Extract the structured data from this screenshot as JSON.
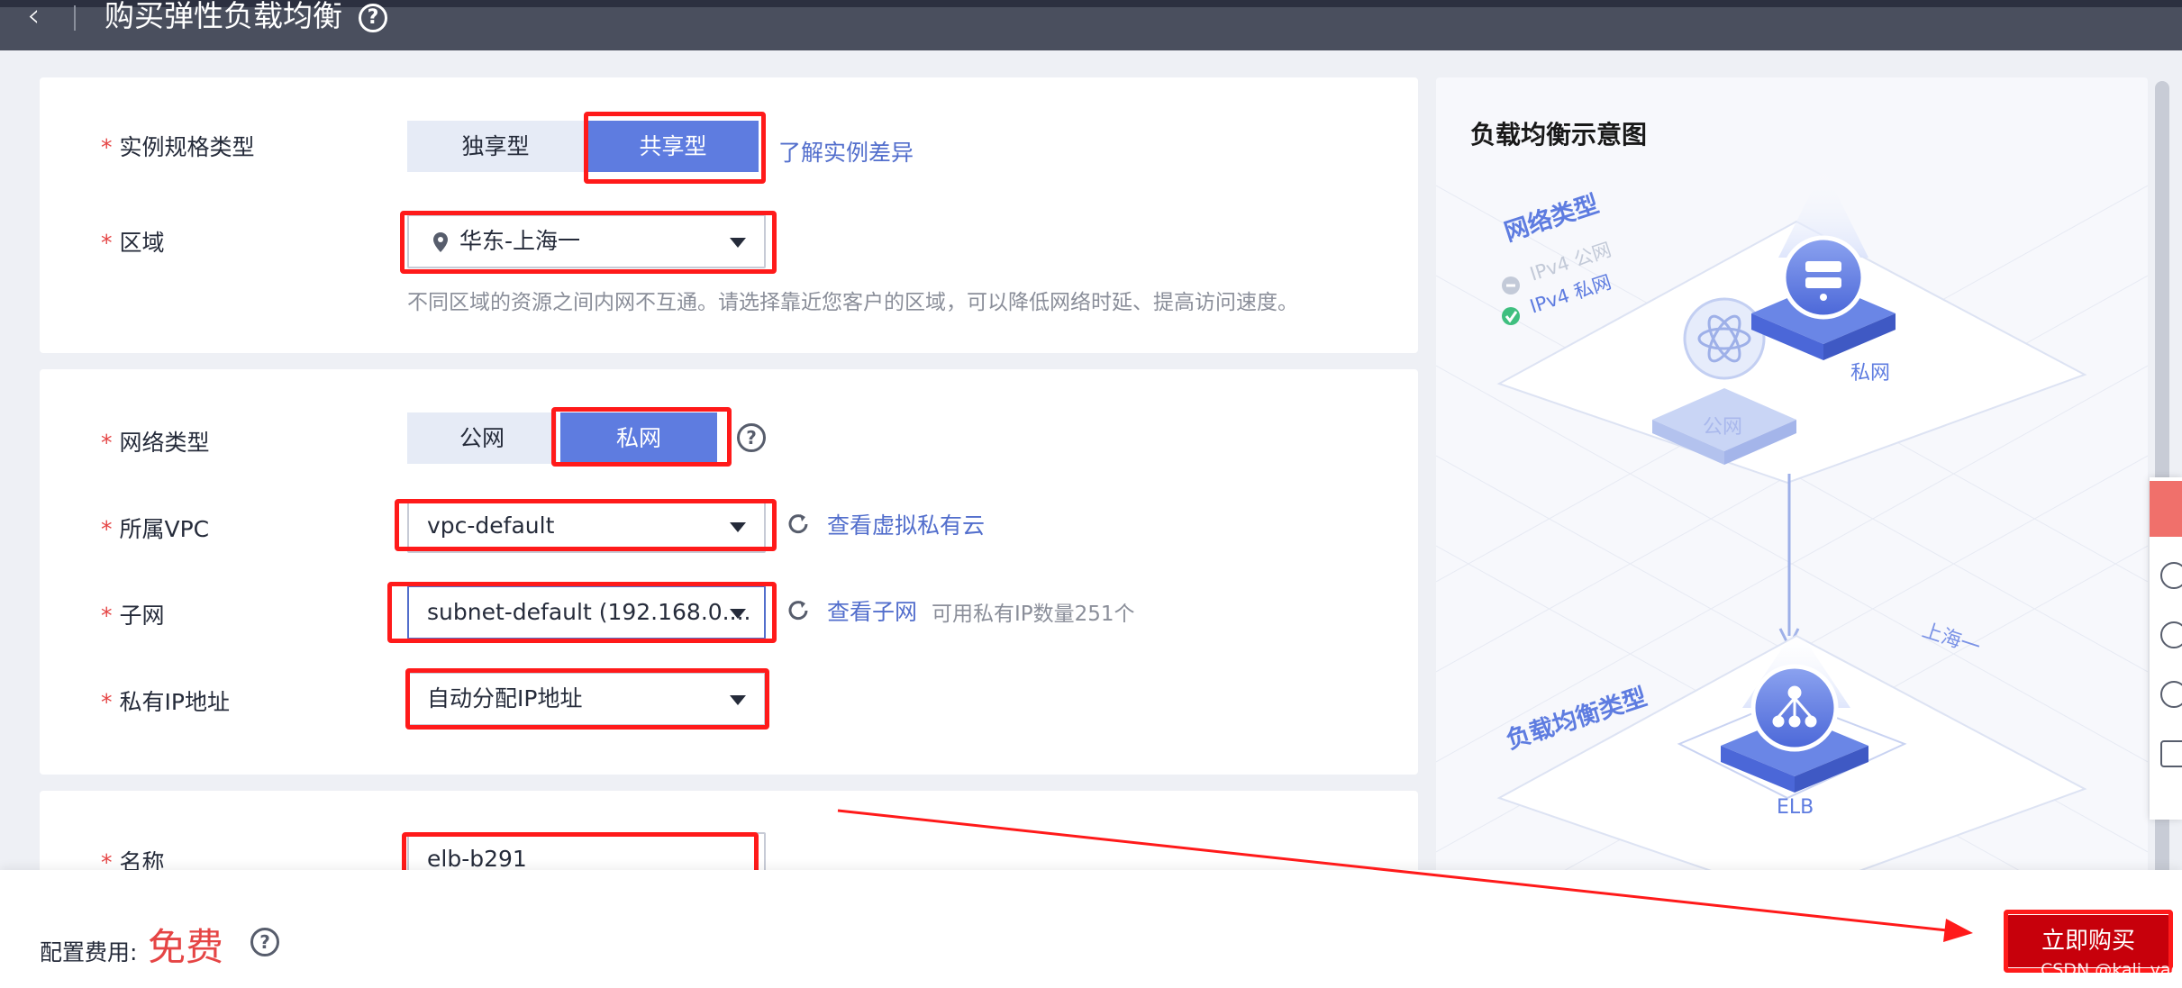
{
  "header": {
    "title": "购买弹性负载均衡",
    "help_glyph": "?"
  },
  "spec": {
    "label": "实例规格类型",
    "options": [
      "独享型",
      "共享型"
    ],
    "selected": "共享型",
    "link": "了解实例差异"
  },
  "region": {
    "label": "区域",
    "value": "华东-上海一",
    "hint": "不同区域的资源之间内网不互通。请选择靠近您客户的区域，可以降低网络时延、提高访问速度。"
  },
  "network": {
    "label": "网络类型",
    "options": [
      "公网",
      "私网"
    ],
    "selected": "私网"
  },
  "vpc": {
    "label": "所属VPC",
    "value": "vpc-default",
    "link": "查看虚拟私有云"
  },
  "subnet": {
    "label": "子网",
    "value": "subnet-default (192.168.0....",
    "link": "查看子网",
    "hint": "可用私有IP数量251个"
  },
  "private_ip": {
    "label": "私有IP地址",
    "value": "自动分配IP地址"
  },
  "name": {
    "label": "名称",
    "value": "elb-b291"
  },
  "required_mark": "*",
  "diagram": {
    "title": "负载均衡示意图",
    "network_type_label": "网络类型",
    "ipv4_public": "IPv4 公网",
    "ipv4_private": "IPv4 私网",
    "public_node": "公网",
    "private_node": "私网",
    "region_label": "上海一",
    "lb_type_label": "负载均衡类型",
    "elb_node": "ELB"
  },
  "footer": {
    "fee_label": "配置费用:",
    "fee_value": "免费",
    "buy_button": "立即购买"
  },
  "watermark": "CSDN @kali_yao",
  "colors": {
    "primary": "#5e7ce0",
    "danger": "#e54545",
    "buy": "#c7000b",
    "annotation": "#ff1a1a"
  }
}
